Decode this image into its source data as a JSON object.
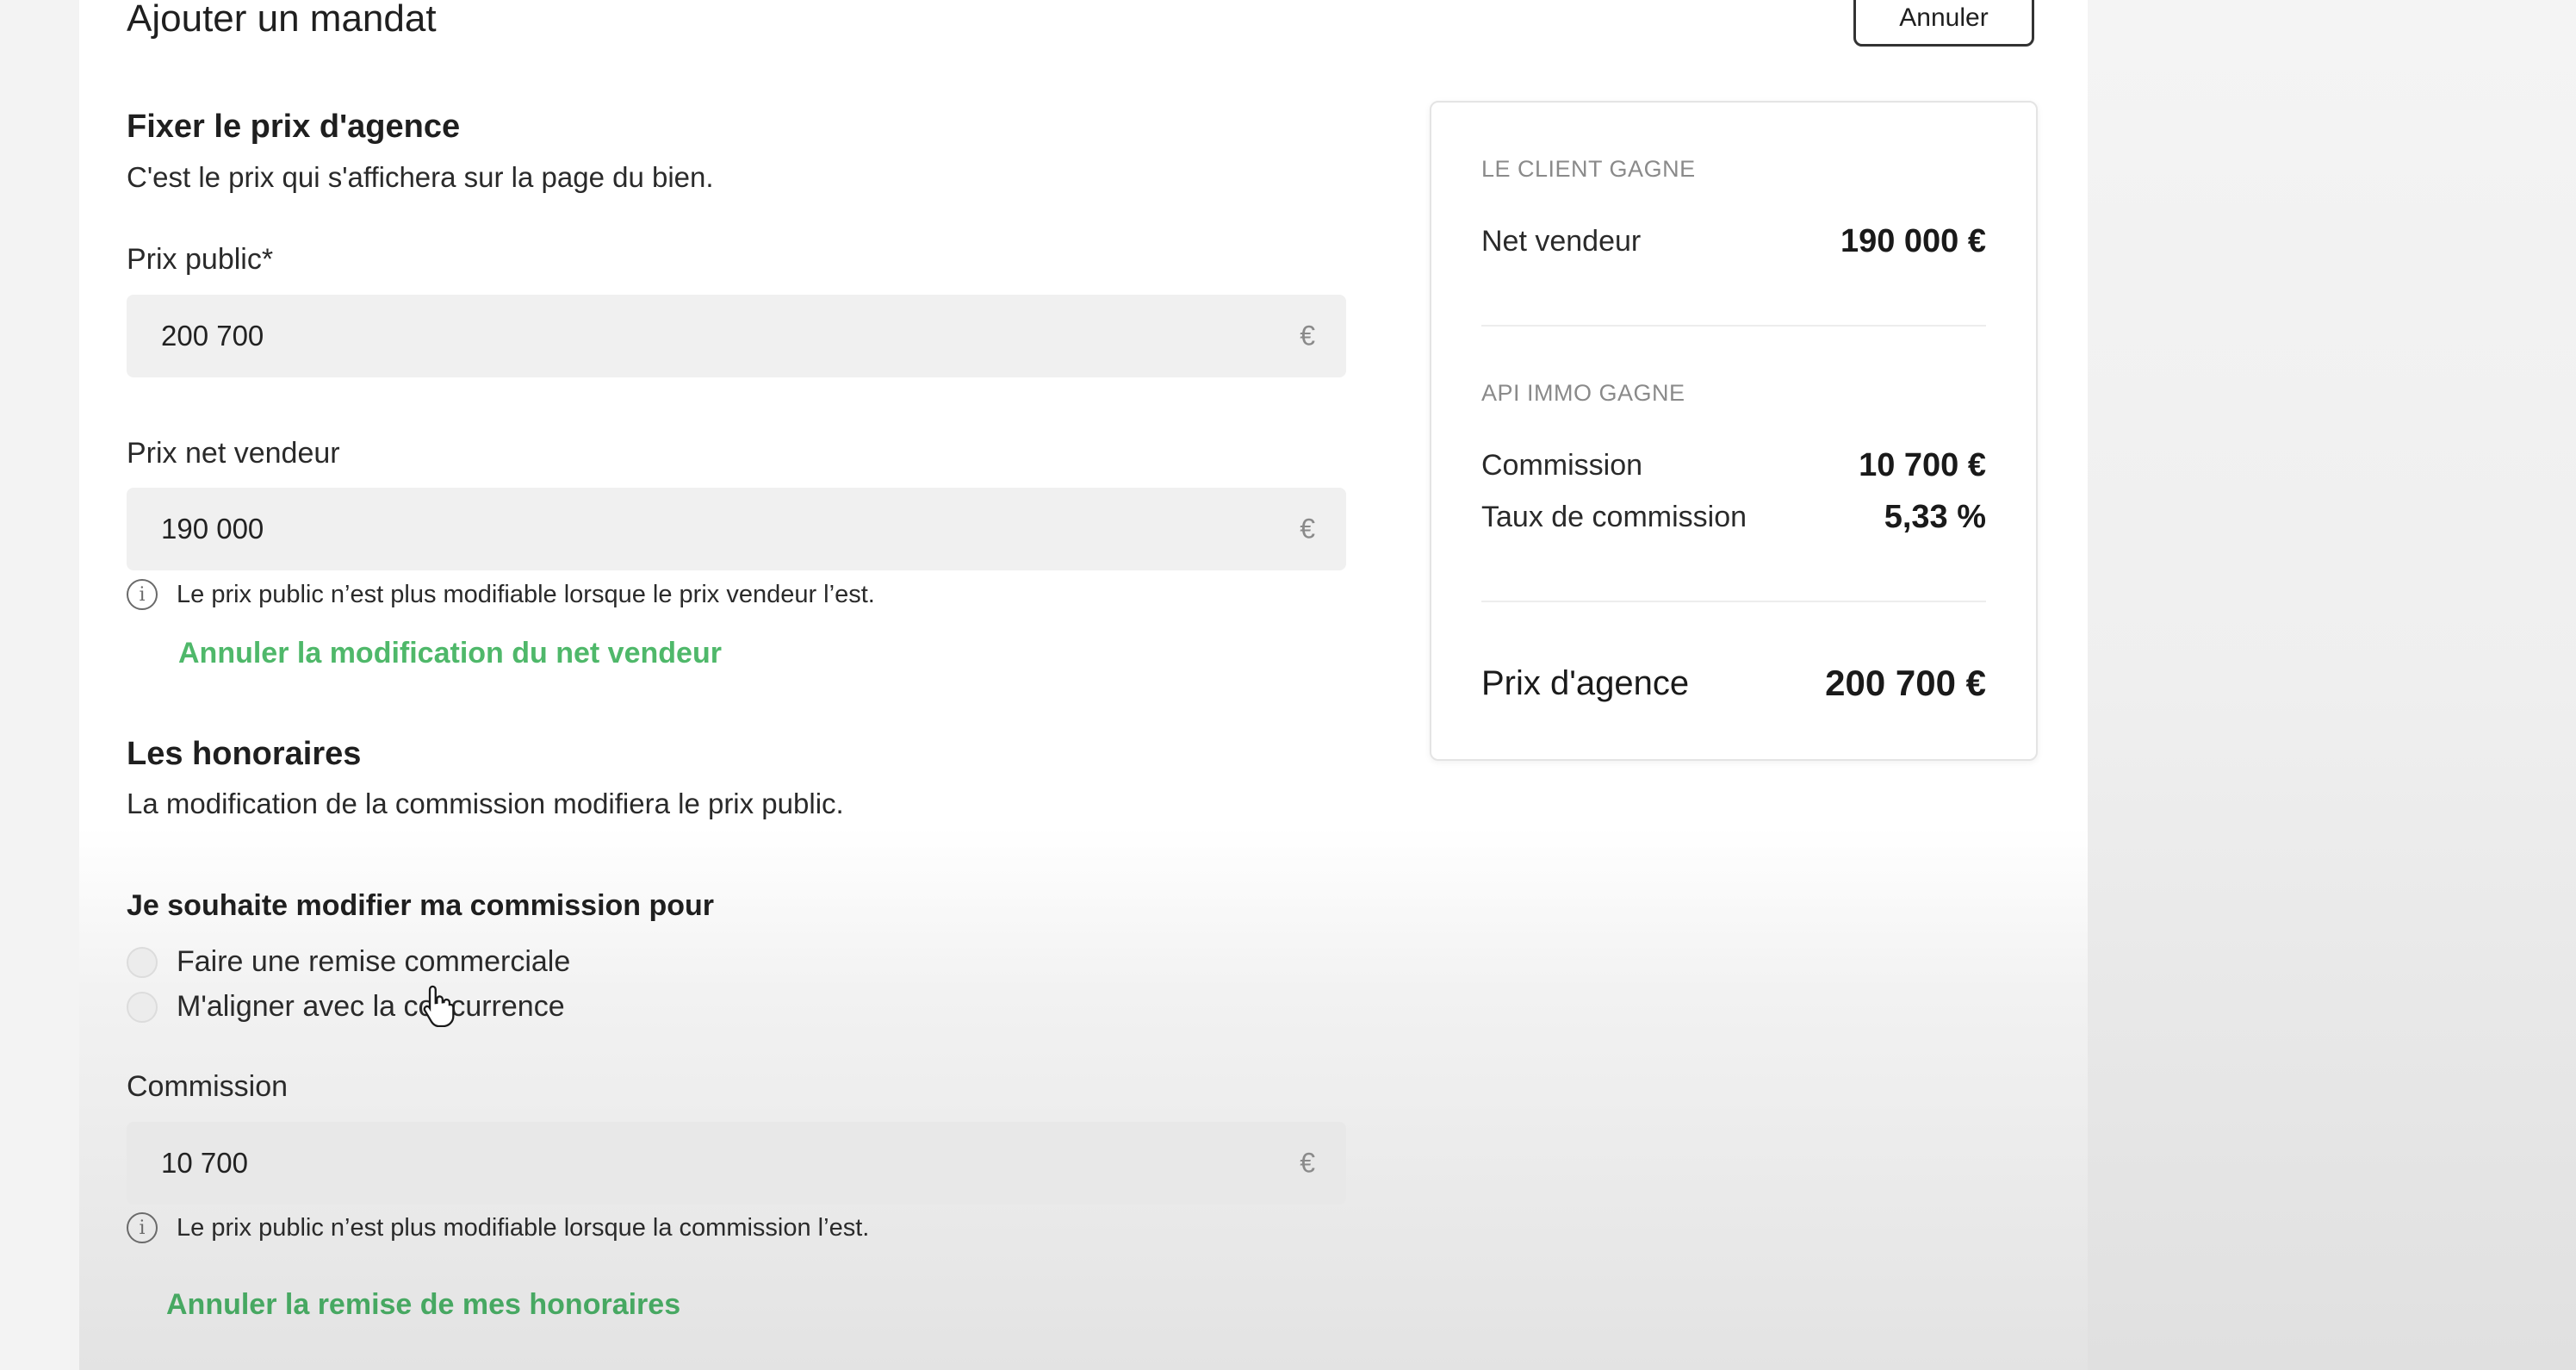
{
  "header": {
    "title": "Ajouter un mandat",
    "cancel_label": "Annuler"
  },
  "pricing_section": {
    "heading": "Fixer le prix d'agence",
    "description": "C'est le prix qui s'affichera sur la page du bien.",
    "public_price": {
      "label": "Prix public*",
      "value": "200 700",
      "currency": "€"
    },
    "net_seller_price": {
      "label": "Prix net vendeur",
      "value": "190 000",
      "currency": "€"
    },
    "info_text": "Le prix public n’est plus modifiable lorsque le prix vendeur l’est.",
    "cancel_link": "Annuler la modification du net vendeur"
  },
  "fees_section": {
    "heading": "Les honoraires",
    "description": "La modification de la commission modifiera le prix public.",
    "question": "Je souhaite modifier ma commission pour",
    "options": [
      {
        "label": "Faire une remise commerciale",
        "selected": false
      },
      {
        "label": "M'aligner avec la concurrence",
        "selected": false
      }
    ],
    "commission": {
      "label": "Commission",
      "value": "10 700",
      "currency": "€"
    },
    "info_text": "Le prix public n’est plus modifiable lorsque la commission l’est.",
    "cancel_link": "Annuler la remise de mes honoraires"
  },
  "summary": {
    "client_caption": "LE CLIENT GAGNE",
    "net_seller_label": "Net vendeur",
    "net_seller_value": "190 000 €",
    "agency_caption": "API IMMO GAGNE",
    "commission_label": "Commission",
    "commission_value": "10 700 €",
    "rate_label": "Taux de commission",
    "rate_value": "5,33 %",
    "agency_price_label": "Prix d'agence",
    "agency_price_value": "200 700 €"
  },
  "colors": {
    "accent_green": "#4fb86a",
    "input_bg": "#f0f0f0",
    "text": "#1f1f1f"
  },
  "icons": {
    "info": "info-circle-icon",
    "cursor": "hand-pointer-icon"
  }
}
